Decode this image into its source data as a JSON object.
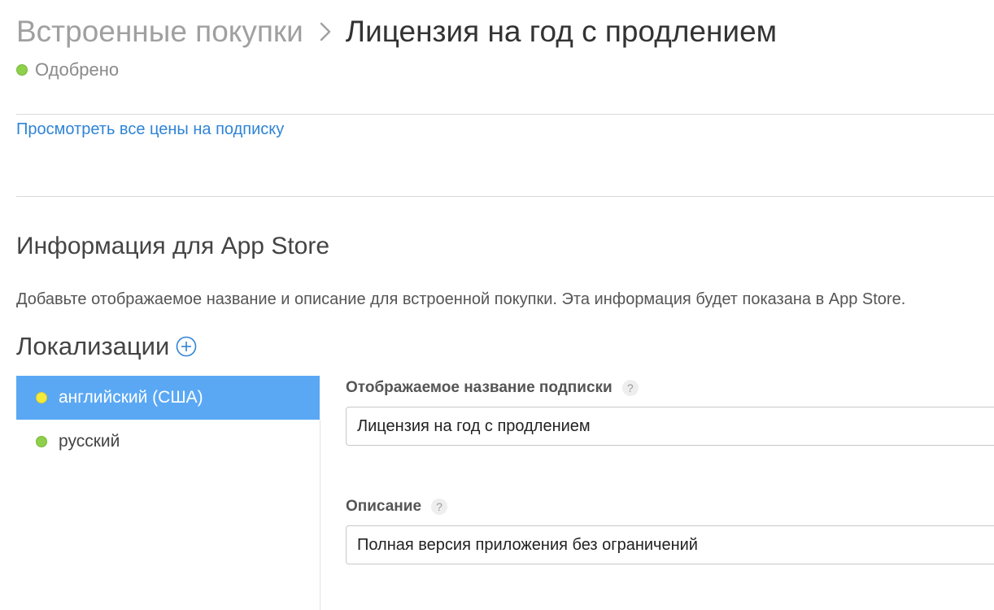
{
  "breadcrumb": {
    "parent": "Встроенные покупки",
    "current": "Лицензия на год с продлением"
  },
  "status": {
    "label": "Одобрено",
    "color": "#8ed04a"
  },
  "links": {
    "view_all_prices": "Просмотреть все цены на подписку"
  },
  "app_store_info": {
    "title": "Информация для App Store",
    "description": "Добавьте отображаемое название и описание для встроенной покупки. Эта информация будет показана в App Store."
  },
  "localizations": {
    "title": "Локализации",
    "add_icon": "plus-circle-icon",
    "items": [
      {
        "label": "английский (США)",
        "status_color": "#f4ea3c",
        "selected": true
      },
      {
        "label": "русский",
        "status_color": "#8ed04a",
        "selected": false
      }
    ]
  },
  "form": {
    "display_name": {
      "label": "Отображаемое название подписки",
      "help": "?",
      "value": "Лицензия на год с продлением"
    },
    "description": {
      "label": "Описание",
      "help": "?",
      "value": "Полная версия приложения без ограничений"
    }
  },
  "colors": {
    "accent": "#2f84d6",
    "selected_row": "#5aa8f4"
  }
}
